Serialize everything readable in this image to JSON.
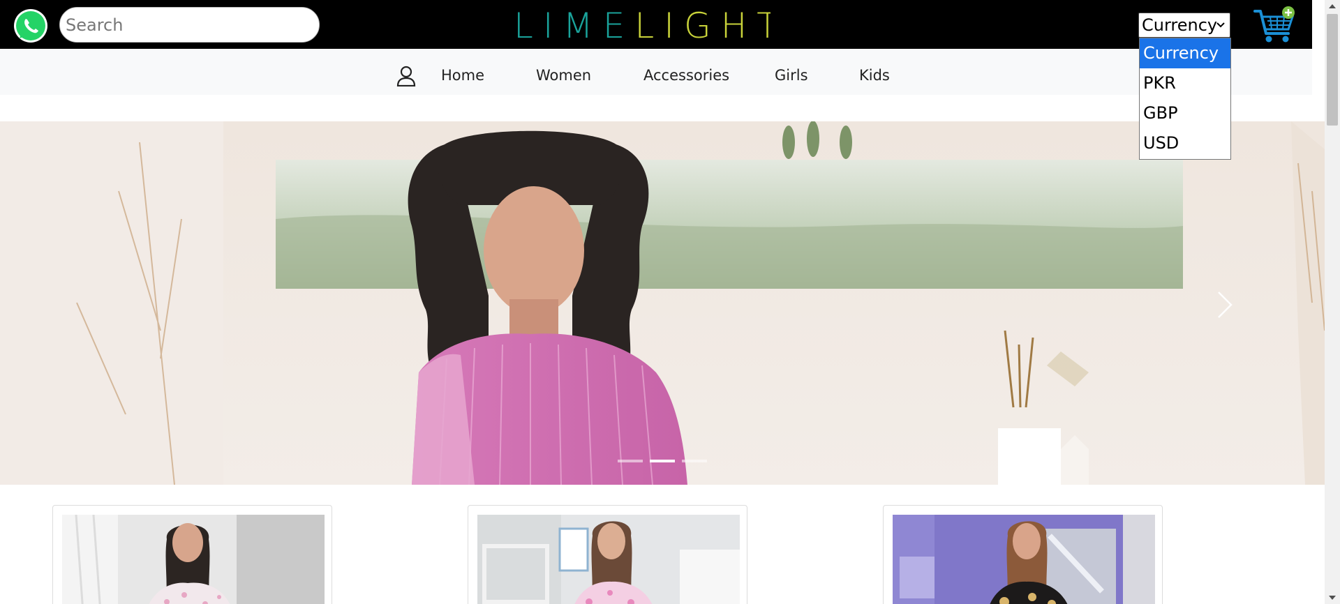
{
  "header": {
    "search_placeholder": "Search",
    "brand": "LIMELIGHT",
    "currency_label": "Currency",
    "icons": {
      "whatsapp": "whatsapp-icon",
      "cart": "cart-icon",
      "chevron": "chevron-down-icon"
    }
  },
  "currency_dropdown": {
    "options": [
      "Currency",
      "PKR",
      "GBP",
      "USD"
    ],
    "selected": "Currency"
  },
  "nav": {
    "items": [
      {
        "label": "Home"
      },
      {
        "label": "Women"
      },
      {
        "label": "Accessories"
      },
      {
        "label": "Girls"
      },
      {
        "label": "Kids"
      }
    ],
    "user_icon": "user-icon"
  },
  "carousel": {
    "slide_count": 3,
    "active_index": 1,
    "next_icon": "chevron-right-icon"
  },
  "colors": {
    "header_bg": "#000000",
    "logo_teal": "#1aa39b",
    "logo_lime": "#c9d33a",
    "nav_bg": "#f8f9fa",
    "dropdown_highlight": "#1a73e8",
    "cart_blue": "#1b90d6",
    "cart_badge_green": "#7bc043"
  }
}
